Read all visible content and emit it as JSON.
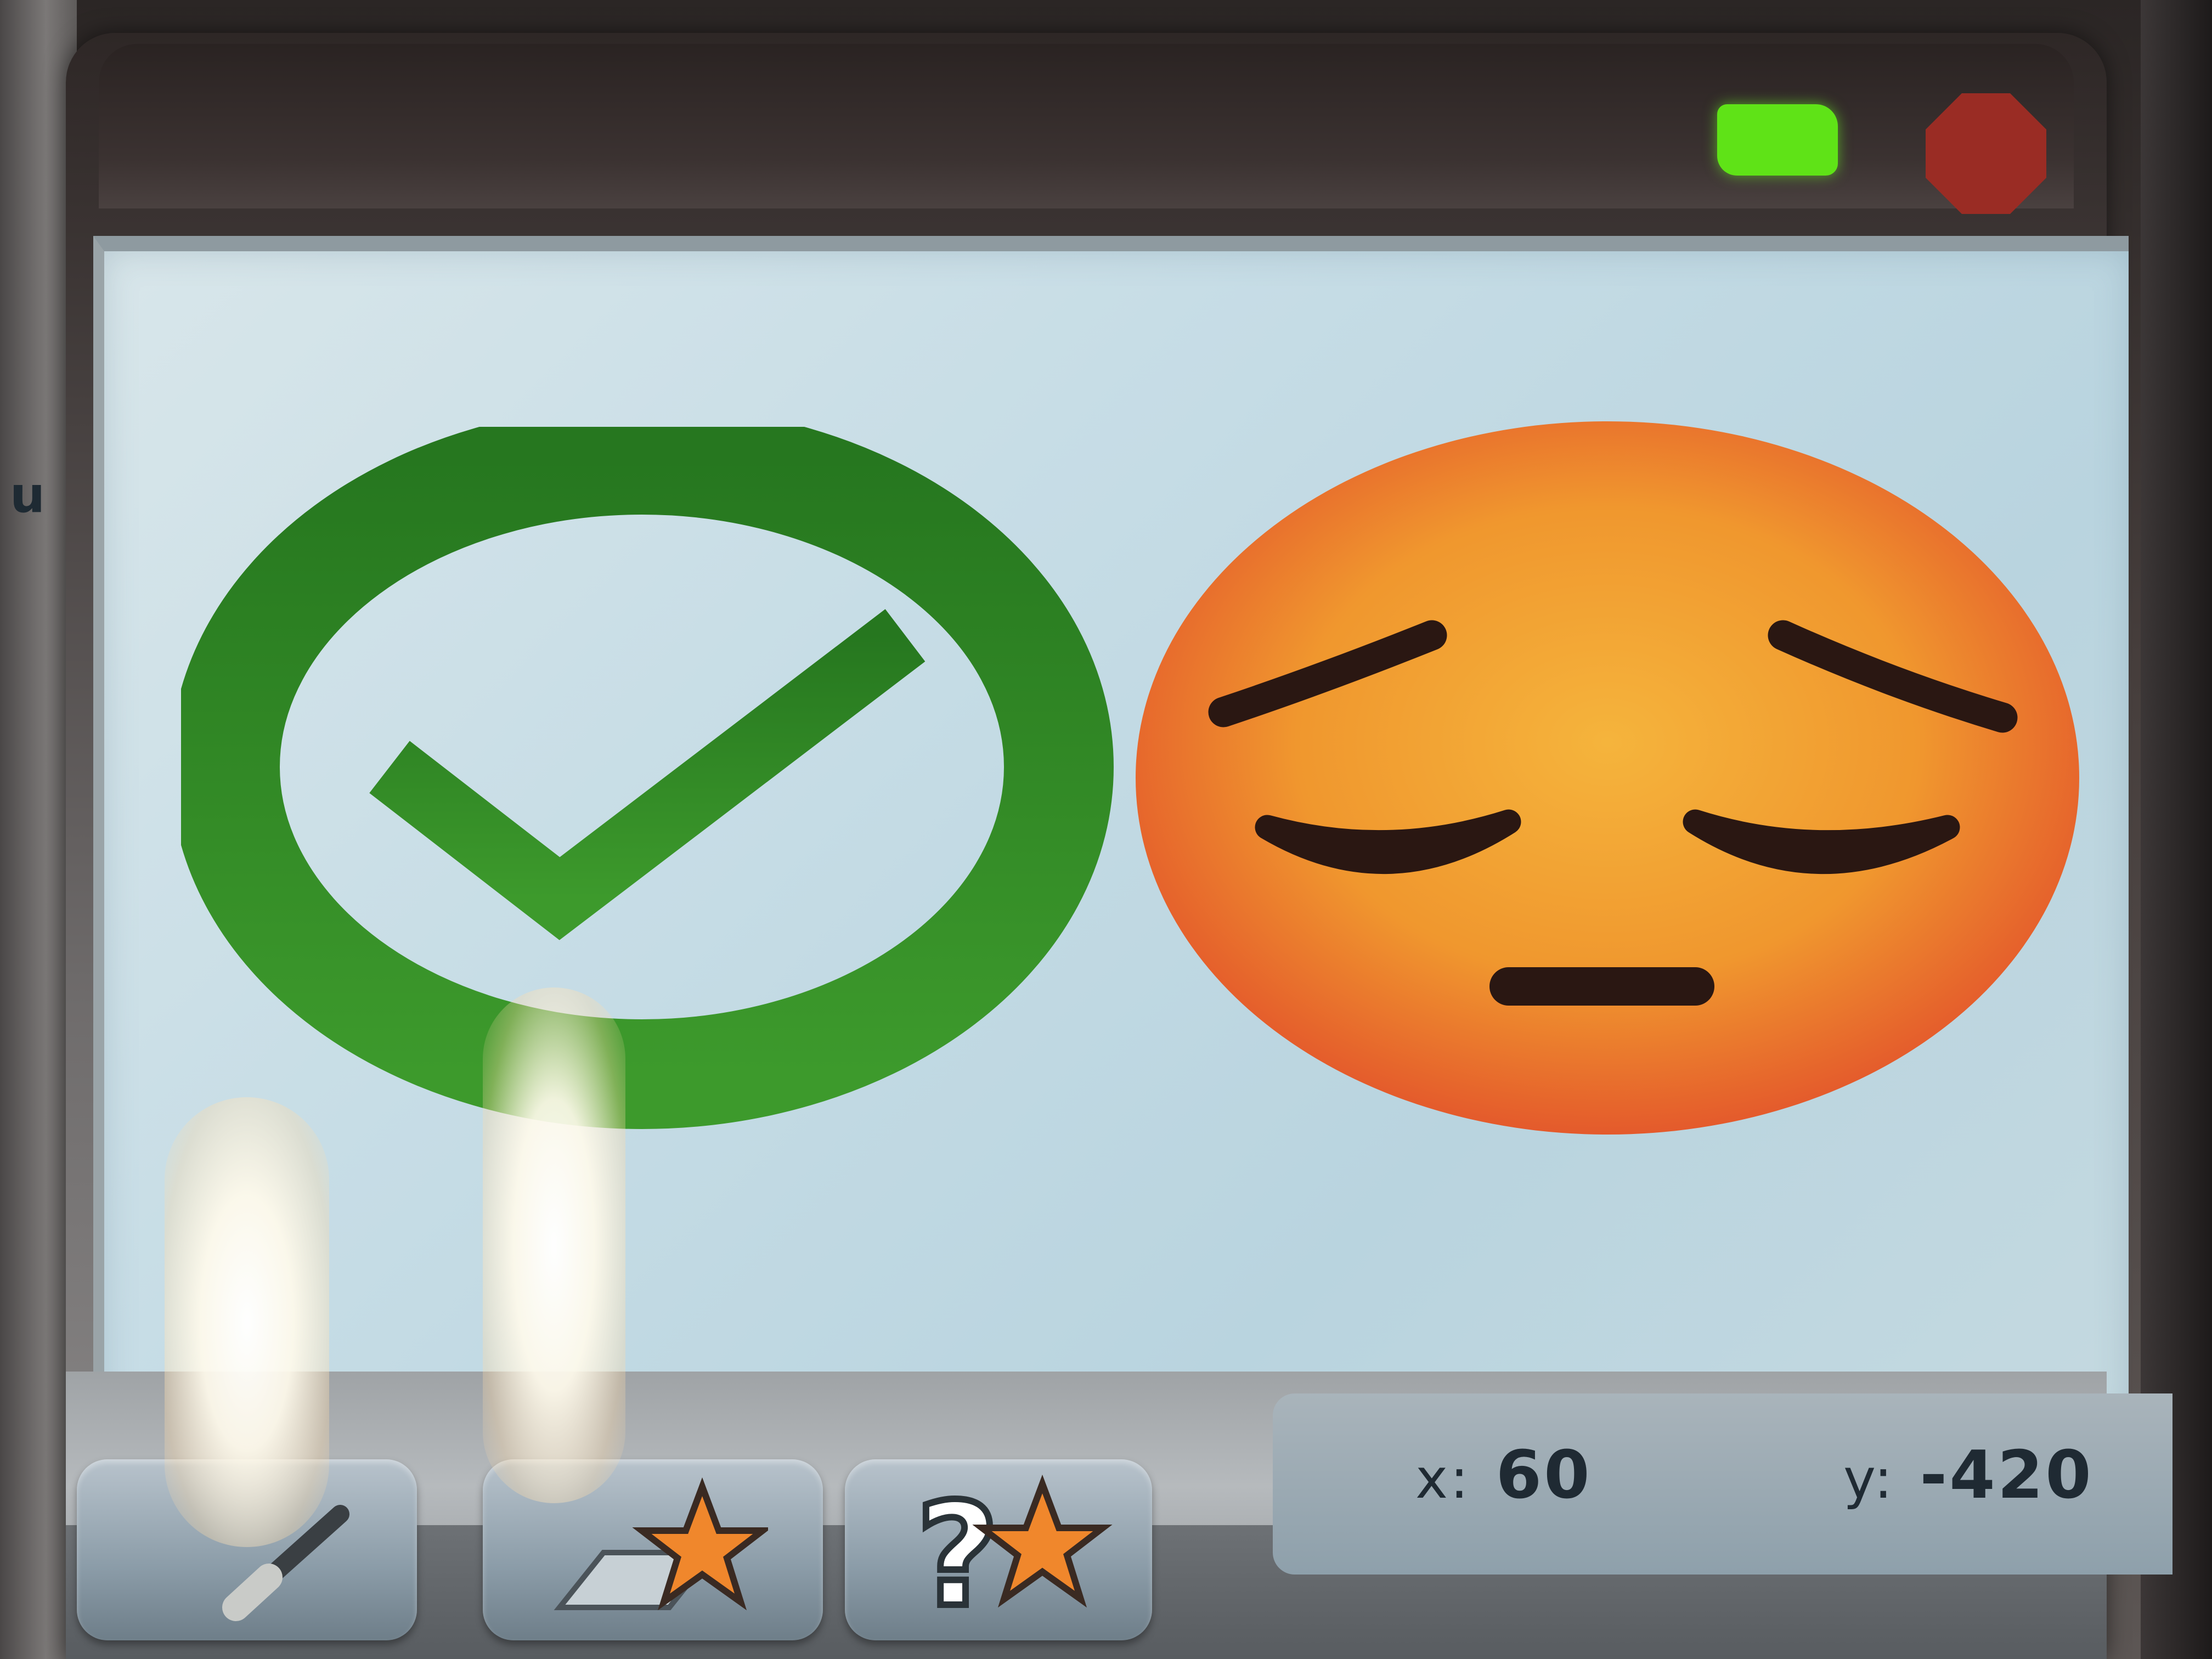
{
  "left_edge": {
    "fragment_text": "u"
  },
  "toolbar": {
    "green_flag_icon": "green-flag-icon",
    "stop_icon": "stop-sign-icon",
    "green_flag_color": "#5fe317",
    "stop_color": "#9a2c24"
  },
  "stage": {
    "background_color": "#c7dde6",
    "sprites": [
      {
        "name": "checkmark-circle",
        "color": "#2a8528"
      },
      {
        "name": "sad-face",
        "color": "#f0a236"
      }
    ]
  },
  "coords": {
    "x_label": "x:",
    "x_value": "60",
    "y_label": "y:",
    "y_value": "-420"
  },
  "sprite_buttons": [
    {
      "icon": "paintbrush-icon"
    },
    {
      "icon": "choose-sprite-star-icon"
    },
    {
      "icon": "random-sprite-question-star-icon"
    }
  ]
}
